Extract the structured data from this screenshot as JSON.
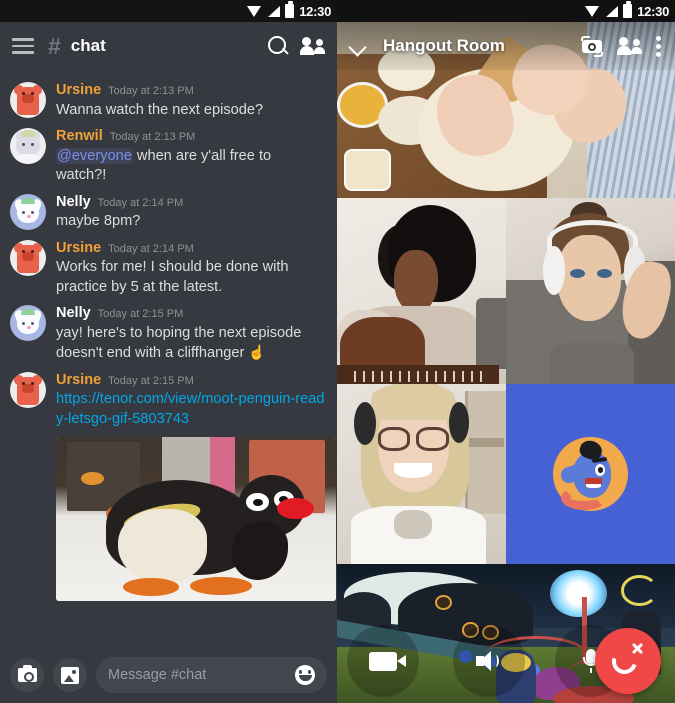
{
  "status_bar": {
    "time": "12:30",
    "icons": [
      "wifi-icon",
      "cellular-icon",
      "battery-icon"
    ]
  },
  "chat": {
    "header": {
      "menu_icon": "hamburger-menu-icon",
      "hash": "#",
      "channel_name": "chat",
      "search_icon": "search-icon",
      "members_icon": "members-icon"
    },
    "messages": [
      {
        "author": "Ursine",
        "author_color": "#f0a138",
        "timestamp": "Today at 2:13 PM",
        "text": "Wanna watch the next episode?",
        "avatar": "ursine-bear-avatar"
      },
      {
        "author": "Renwil",
        "author_color": "#f0a138",
        "timestamp": "Today at 2:13 PM",
        "mention": "@everyone",
        "text": " when are y'all free to watch?!",
        "avatar": "renwil-cat-avatar"
      },
      {
        "author": "Nelly",
        "author_color": "#ffffff",
        "timestamp": "Today at 2:14 PM",
        "text": "maybe 8pm?",
        "avatar": "nelly-cat-avatar"
      },
      {
        "author": "Ursine",
        "author_color": "#f0a138",
        "timestamp": "Today at 2:14 PM",
        "text": "Works for me! I should be done with practice by 5 at the latest.",
        "avatar": "ursine-bear-avatar"
      },
      {
        "author": "Nelly",
        "author_color": "#ffffff",
        "timestamp": "Today at 2:15 PM",
        "text": "yay! here's to hoping the next episode doesn't end with a cliffhanger ",
        "emoji": "☝",
        "avatar": "nelly-cat-avatar"
      },
      {
        "author": "Ursine",
        "author_color": "#f0a138",
        "timestamp": "Today at 2:15 PM",
        "link": "https://tenor.com/view/moot-penguin-ready-letsgo-gif-5803743",
        "attachment": "penguin-gif",
        "avatar": "ursine-bear-avatar"
      }
    ],
    "input": {
      "camera_icon": "camera-icon",
      "gallery_icon": "image-icon",
      "placeholder": "Message #chat",
      "emoji_icon": "emoji-icon"
    }
  },
  "call": {
    "header": {
      "collapse_icon": "chevron-down-icon",
      "title": "Hangout Room",
      "switch_camera_icon": "switch-camera-icon",
      "participants_icon": "participants-icon",
      "overflow_icon": "more-options-icon"
    },
    "participants": [
      {
        "name": "baking-video-tile",
        "kind": "video"
      },
      {
        "name": "guitar-video-tile",
        "kind": "video"
      },
      {
        "name": "headphones-video-tile",
        "kind": "video"
      },
      {
        "name": "blonde-video-tile",
        "kind": "video"
      },
      {
        "name": "genie-avatar-tile",
        "kind": "avatar",
        "color": "#4661d4"
      },
      {
        "name": "game-stream-tile",
        "kind": "screenshare"
      }
    ],
    "controls": {
      "video_icon": "video-camera-icon",
      "speaker_icon": "speaker-icon",
      "microphone_icon": "microphone-icon",
      "hangup_icon": "end-call-icon",
      "hangup_color": "#f04747"
    }
  }
}
